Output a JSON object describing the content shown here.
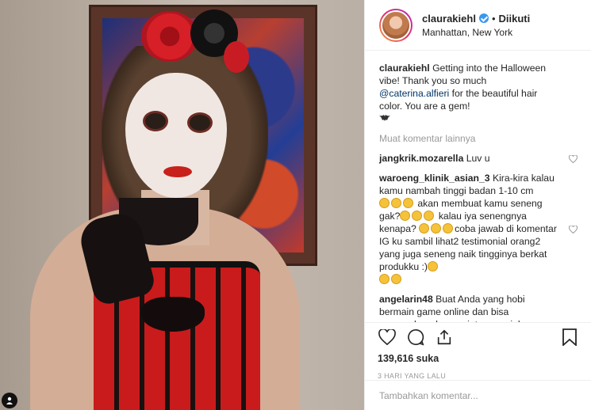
{
  "post": {
    "user_tag_icon": "person-icon"
  },
  "header": {
    "username": "claurakiehl",
    "separator": "•",
    "follow_label": "Diikuti",
    "location": "Manhattan, New York"
  },
  "caption": {
    "username": "claurakiehl",
    "text_before": "Getting into the Halloween vibe! Thank you so much",
    "mention": "@caterina.alfieri",
    "text_after": "for the beautiful hair color. You are a gem!"
  },
  "load_more_label": "Muat komentar lainnya",
  "comments": [
    {
      "username": "jangkrik.mozarella",
      "text": "Luv u"
    },
    {
      "username": "waroeng_klinik_asian_3",
      "text_1": "Kira-kira kalau kamu nambah tinggi badan 1-10 cm",
      "text_2": "akan membuat kamu seneng gak?",
      "text_3": "kalau iya senengnya kenapa?",
      "text_4": "coba jawab di komentar IG ku sambil lihat2 testimonial orang2 yang juga seneng naik tingginya berkat produkku :)"
    },
    {
      "username": "angelarin48",
      "text": "Buat Anda yang hobi bermain game online dan bisa menangkan dengan jutaan rupiah nya loh..hanya di SANADOMINO"
    }
  ],
  "actions": {
    "icons": [
      "heart-icon",
      "comment-icon",
      "share-icon",
      "bookmark-icon"
    ],
    "likes": "139,616 suka",
    "time": "3 HARI YANG LALU"
  },
  "add_comment": {
    "placeholder": "Tambahkan komentar...",
    "menu_label": "•••"
  },
  "colors": {
    "link": "#003569",
    "verified": "#3897f0",
    "muted": "#999999"
  }
}
